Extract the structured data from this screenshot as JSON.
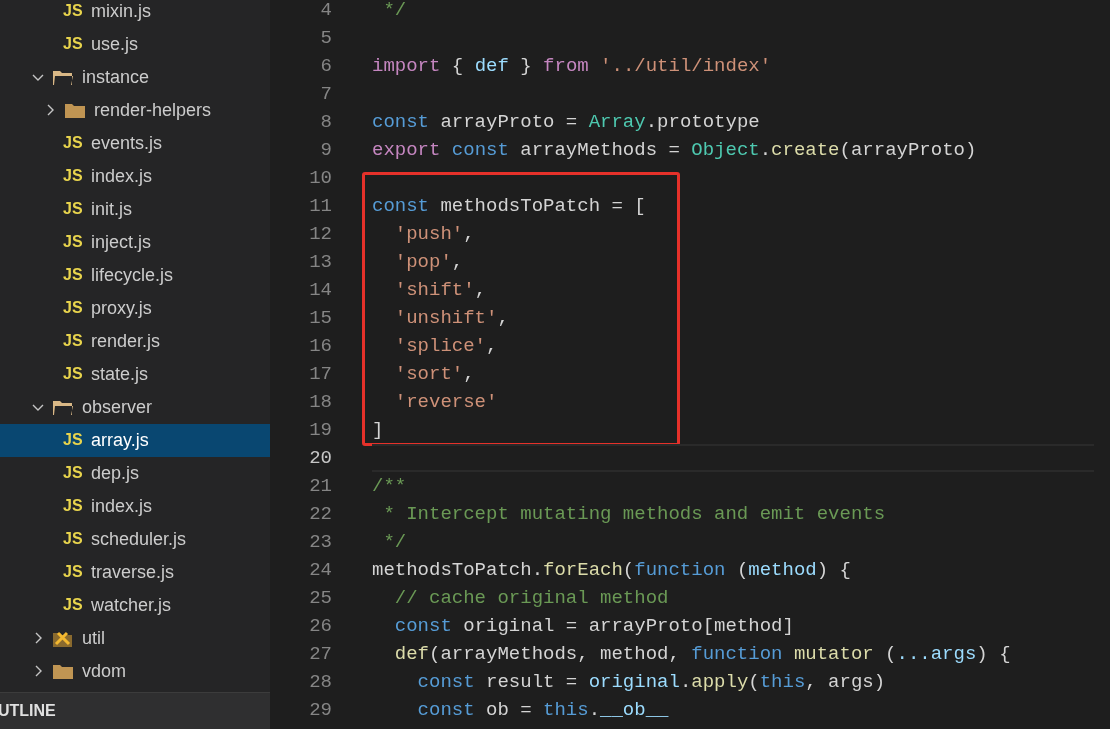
{
  "sidebar": {
    "continued_files": [
      {
        "name": "mixin.js",
        "badge": "JS",
        "selected": false
      },
      {
        "name": "use.js",
        "badge": "JS",
        "selected": false
      }
    ],
    "tree": [
      {
        "name": "instance",
        "kind": "folder",
        "expanded": true,
        "children": [
          {
            "name": "render-helpers",
            "kind": "folder",
            "expanded": false
          },
          {
            "name": "events.js",
            "kind": "file",
            "badge": "JS",
            "selected": false
          },
          {
            "name": "index.js",
            "kind": "file",
            "badge": "JS",
            "selected": false
          },
          {
            "name": "init.js",
            "kind": "file",
            "badge": "JS",
            "selected": false
          },
          {
            "name": "inject.js",
            "kind": "file",
            "badge": "JS",
            "selected": false
          },
          {
            "name": "lifecycle.js",
            "kind": "file",
            "badge": "JS",
            "selected": false
          },
          {
            "name": "proxy.js",
            "kind": "file",
            "badge": "JS",
            "selected": false
          },
          {
            "name": "render.js",
            "kind": "file",
            "badge": "JS",
            "selected": false
          },
          {
            "name": "state.js",
            "kind": "file",
            "badge": "JS",
            "selected": false
          }
        ]
      },
      {
        "name": "observer",
        "kind": "folder",
        "expanded": true,
        "children": [
          {
            "name": "array.js",
            "kind": "file",
            "badge": "JS",
            "selected": true
          },
          {
            "name": "dep.js",
            "kind": "file",
            "badge": "JS",
            "selected": false
          },
          {
            "name": "index.js",
            "kind": "file",
            "badge": "JS",
            "selected": false
          },
          {
            "name": "scheduler.js",
            "kind": "file",
            "badge": "JS",
            "selected": false
          },
          {
            "name": "traverse.js",
            "kind": "file",
            "badge": "JS",
            "selected": false
          },
          {
            "name": "watcher.js",
            "kind": "file",
            "badge": "JS",
            "selected": false
          }
        ]
      },
      {
        "name": "util",
        "kind": "tools-folder",
        "expanded": false
      },
      {
        "name": "vdom",
        "kind": "folder",
        "expanded": false
      }
    ],
    "outline_header": "UTLINE"
  },
  "editor": {
    "blocks": [
      {
        "framed": false,
        "lines": [
          {
            "number": "4",
            "current": false,
            "tokens": [
              {
                "kind": "comment",
                "text": " */"
              }
            ]
          },
          {
            "number": "5",
            "current": false
          },
          {
            "number": "6",
            "current": false,
            "tokens": [
              {
                "kind": "kw",
                "text": "import"
              },
              {
                "kind": "plain",
                "text": " { "
              },
              {
                "kind": "var",
                "text": "def"
              },
              {
                "kind": "plain",
                "text": " } "
              },
              {
                "kind": "kw",
                "text": "from "
              },
              {
                "kind": "str",
                "text": "'../util/index'"
              }
            ]
          },
          {
            "number": "7",
            "current": false
          },
          {
            "number": "8",
            "current": false,
            "tokens": [
              {
                "kind": "decl",
                "text": "const"
              },
              {
                "kind": "plain",
                "text": " arrayProto = "
              },
              {
                "kind": "type",
                "text": "Array"
              },
              {
                "kind": "plain",
                "text": ".prototype"
              }
            ]
          },
          {
            "number": "9",
            "current": false,
            "tokens": [
              {
                "kind": "kw",
                "text": "export "
              },
              {
                "kind": "decl",
                "text": "const"
              },
              {
                "kind": "plain",
                "text": " arrayMethods = "
              },
              {
                "kind": "type",
                "text": "Object"
              },
              {
                "kind": "plain",
                "text": "."
              },
              {
                "kind": "fn",
                "text": "create"
              },
              {
                "kind": "plain",
                "text": "(arrayProto)"
              }
            ]
          }
        ]
      },
      {
        "framed": true,
        "lines": [
          {
            "number": "10",
            "current": false
          },
          {
            "number": "11",
            "current": false,
            "tokens": [
              {
                "kind": "decl",
                "text": "const"
              },
              {
                "kind": "plain",
                "text": " methodsToPatch = ["
              }
            ]
          },
          {
            "number": "12",
            "current": false,
            "tokens": [
              {
                "kind": "str",
                "text": "  'push'"
              },
              {
                "kind": "plain",
                "text": ","
              }
            ]
          },
          {
            "number": "13",
            "current": false,
            "tokens": [
              {
                "kind": "str",
                "text": "  'pop'"
              },
              {
                "kind": "plain",
                "text": ","
              }
            ]
          },
          {
            "number": "14",
            "current": false,
            "tokens": [
              {
                "kind": "str",
                "text": "  'shift'"
              },
              {
                "kind": "plain",
                "text": ","
              }
            ]
          },
          {
            "number": "15",
            "current": false,
            "tokens": [
              {
                "kind": "str",
                "text": "  'unshift'"
              },
              {
                "kind": "plain",
                "text": ","
              }
            ]
          },
          {
            "number": "16",
            "current": false,
            "tokens": [
              {
                "kind": "str",
                "text": "  'splice'"
              },
              {
                "kind": "plain",
                "text": ","
              }
            ]
          },
          {
            "number": "17",
            "current": false,
            "tokens": [
              {
                "kind": "str",
                "text": "  'sort'"
              },
              {
                "kind": "plain",
                "text": ","
              }
            ]
          },
          {
            "number": "18",
            "current": false,
            "tokens": [
              {
                "kind": "str",
                "text": "  'reverse'"
              }
            ]
          },
          {
            "number": "19",
            "current": false,
            "tokens": [
              {
                "kind": "plain",
                "text": "]"
              }
            ]
          }
        ]
      },
      {
        "framed": false,
        "lines": [
          {
            "number": "20",
            "current": true
          },
          {
            "number": "21",
            "current": false,
            "tokens": [
              {
                "kind": "comment",
                "text": "/**"
              }
            ]
          },
          {
            "number": "22",
            "current": false,
            "tokens": [
              {
                "kind": "comment",
                "text": " * Intercept mutating methods and emit events"
              }
            ]
          },
          {
            "number": "23",
            "current": false,
            "tokens": [
              {
                "kind": "comment",
                "text": " */"
              }
            ]
          },
          {
            "number": "24",
            "current": false,
            "tokens": [
              {
                "kind": "plain",
                "text": "methodsToPatch."
              },
              {
                "kind": "fn",
                "text": "forEach"
              },
              {
                "kind": "plain",
                "text": "("
              },
              {
                "kind": "decl",
                "text": "function"
              },
              {
                "kind": "plain",
                "text": " ("
              },
              {
                "kind": "var",
                "text": "method"
              },
              {
                "kind": "plain",
                "text": ") {"
              }
            ]
          },
          {
            "number": "25",
            "current": false,
            "tokens": [
              {
                "kind": "comment",
                "text": "  // cache original method"
              }
            ]
          },
          {
            "number": "26",
            "current": false,
            "tokens": [
              {
                "kind": "decl",
                "text": "  const"
              },
              {
                "kind": "plain",
                "text": " original = arrayProto[method]"
              }
            ]
          },
          {
            "number": "27",
            "current": false,
            "tokens": [
              {
                "kind": "fn",
                "text": "  def"
              },
              {
                "kind": "plain",
                "text": "(arrayMethods, method, "
              },
              {
                "kind": "decl",
                "text": "function"
              },
              {
                "kind": "fn",
                "text": " mutator"
              },
              {
                "kind": "plain",
                "text": " ("
              },
              {
                "kind": "var",
                "text": "...args"
              },
              {
                "kind": "plain",
                "text": ") {"
              }
            ]
          },
          {
            "number": "28",
            "current": false,
            "tokens": [
              {
                "kind": "decl",
                "text": "    const"
              },
              {
                "kind": "plain",
                "text": " result = "
              },
              {
                "kind": "var",
                "text": "original"
              },
              {
                "kind": "plain",
                "text": "."
              },
              {
                "kind": "fn",
                "text": "apply"
              },
              {
                "kind": "plain",
                "text": "("
              },
              {
                "kind": "decl",
                "text": "this"
              },
              {
                "kind": "plain",
                "text": ", args)"
              }
            ]
          },
          {
            "number": "29",
            "current": false,
            "tokens": [
              {
                "kind": "decl",
                "text": "    const"
              },
              {
                "kind": "plain",
                "text": " ob = "
              },
              {
                "kind": "decl",
                "text": "this"
              },
              {
                "kind": "plain",
                "text": "."
              },
              {
                "kind": "var",
                "text": "__ob__"
              }
            ]
          }
        ]
      }
    ]
  }
}
